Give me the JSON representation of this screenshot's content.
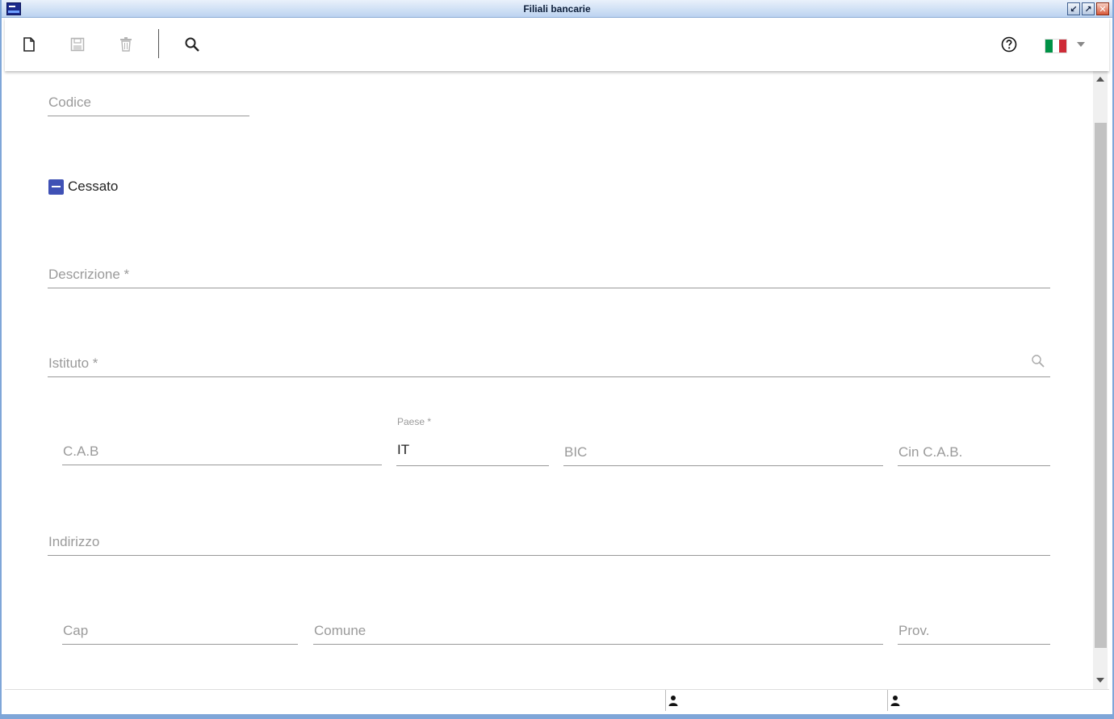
{
  "window": {
    "title": "Filiali bancarie",
    "buttons": {
      "minimize": "↙",
      "maximize": "↗",
      "close": "✕"
    }
  },
  "toolbar": {
    "new_icon": "new-document-icon",
    "save_icon": "save-icon",
    "delete_icon": "trash-icon",
    "search_icon": "search-icon",
    "help_icon": "help-icon",
    "language_flag": "italy-flag-icon",
    "flag_colors": [
      "#009246",
      "#ffffff",
      "#ce2b37"
    ]
  },
  "form": {
    "codice": {
      "label": "Codice",
      "value": ""
    },
    "cessato": {
      "label": "Cessato",
      "state": "indeterminate"
    },
    "descrizione": {
      "label": "Descrizione *",
      "value": ""
    },
    "istituto": {
      "label": "Istituto *",
      "value": ""
    },
    "cab": {
      "label": "C.A.B",
      "value": ""
    },
    "paese": {
      "label": "Paese *",
      "value": "IT"
    },
    "bic": {
      "label": "BIC",
      "value": ""
    },
    "cin_cab": {
      "label": "Cin C.A.B.",
      "value": ""
    },
    "indirizzo": {
      "label": "Indirizzo",
      "value": ""
    },
    "cap": {
      "label": "Cap",
      "value": ""
    },
    "comune": {
      "label": "Comune",
      "value": ""
    },
    "prov": {
      "label": "Prov.",
      "value": ""
    }
  },
  "colors": {
    "accent": "#3f51b5",
    "frame": "#7fa6d8"
  }
}
